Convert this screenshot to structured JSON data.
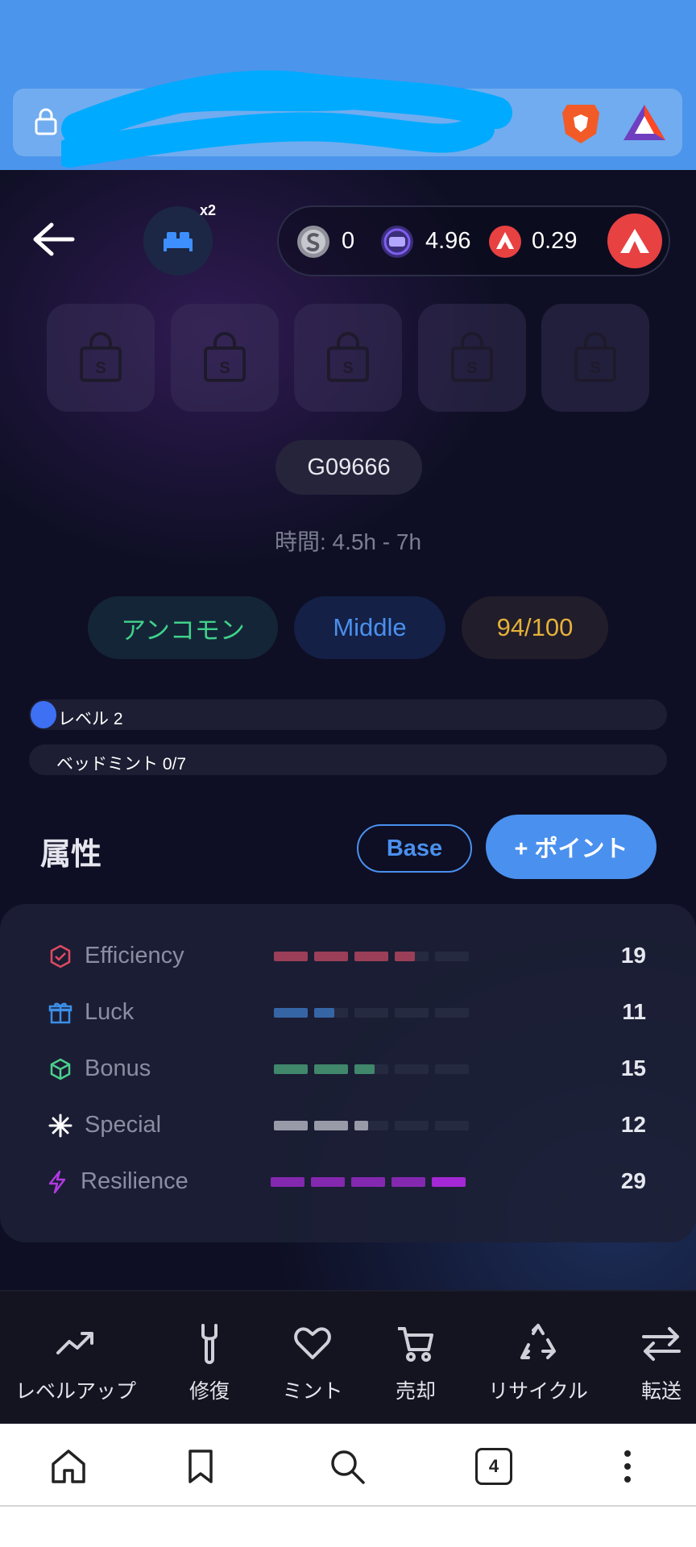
{
  "browser": {
    "url_redacted": true,
    "tab_count": "4"
  },
  "header": {
    "bed_multiplier": "x2",
    "balances": [
      {
        "icon": "gst-coin-icon",
        "value": "0"
      },
      {
        "icon": "gmt-coin-icon",
        "value": "4.96"
      },
      {
        "icon": "avax-coin-icon",
        "value": "0.29"
      }
    ]
  },
  "bed": {
    "id": "G09666",
    "time": "時間: 4.5h - 7h",
    "rarity": "アンコモン",
    "type": "Middle",
    "durability": "94/100",
    "level_label": "レベル 2",
    "bedmint_label": "ベッドミント 0/7"
  },
  "attributes": {
    "title": "属性",
    "base_label": "Base",
    "point_label": "+ ポイント",
    "rows": [
      {
        "name": "Efficiency",
        "value": "19",
        "fill": 3.6,
        "color": "#c2475f",
        "icon": "efficiency-icon"
      },
      {
        "name": "Luck",
        "value": "11",
        "fill": 1.6,
        "color": "#3c79c8",
        "icon": "luck-gift-icon"
      },
      {
        "name": "Bonus",
        "value": "15",
        "fill": 2.6,
        "color": "#4aa77a",
        "icon": "bonus-box-icon"
      },
      {
        "name": "Special",
        "value": "12",
        "fill": 2.4,
        "color": "#bfc1c9",
        "icon": "special-sparkle-icon"
      },
      {
        "name": "Resilience",
        "value": "29",
        "fill": 5,
        "color": "#a428d6",
        "icon": "resilience-bolt-icon"
      }
    ]
  },
  "actions": [
    {
      "label": "レベルアップ",
      "icon": "trend-up-icon"
    },
    {
      "label": "修復",
      "icon": "wrench-icon"
    },
    {
      "label": "ミント",
      "icon": "heart-icon"
    },
    {
      "label": "売却",
      "icon": "cart-icon"
    },
    {
      "label": "リサイクル",
      "icon": "recycle-icon"
    },
    {
      "label": "転送",
      "icon": "transfer-icon"
    }
  ],
  "colors": {
    "accent": "#4a90ee",
    "avax": "#e84142",
    "uncommon": "#3fd28a",
    "durability": "#e5b13a"
  }
}
